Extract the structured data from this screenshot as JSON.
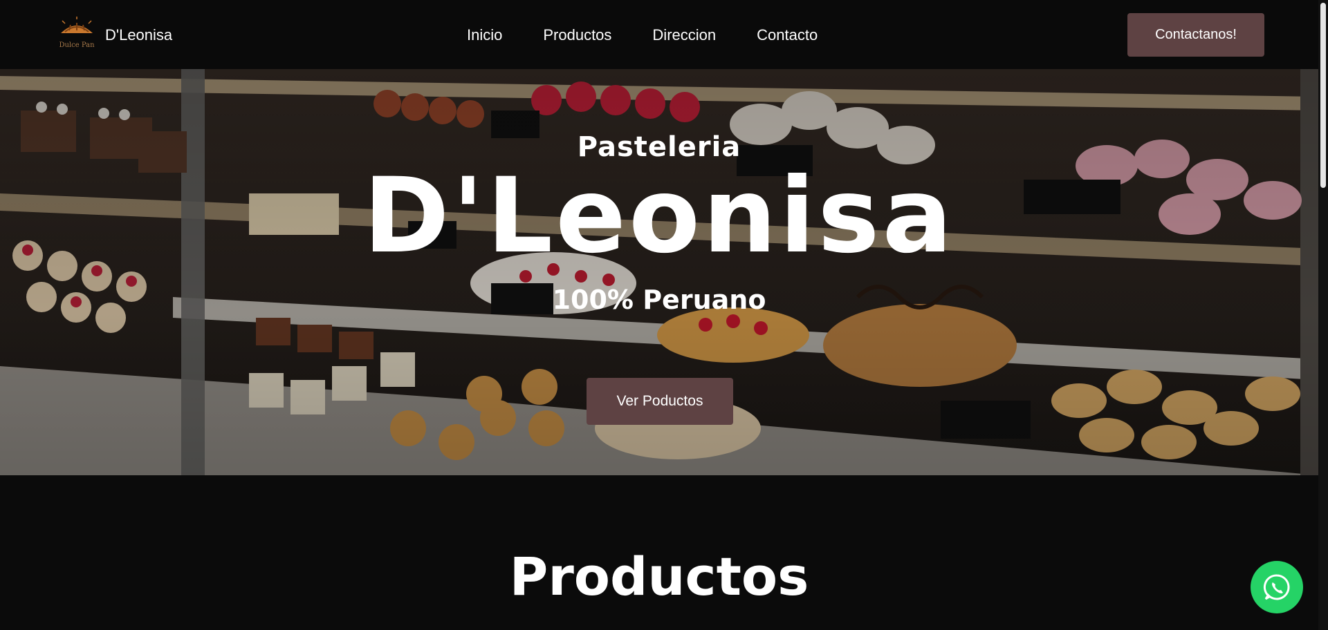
{
  "header": {
    "brand_name": "D'Leonisa",
    "logo_text": "Dulce Pan",
    "logo_icon": "bread-logo-icon",
    "nav": [
      {
        "label": "Inicio"
      },
      {
        "label": "Productos"
      },
      {
        "label": "Direccion"
      },
      {
        "label": "Contacto"
      }
    ],
    "cta_label": "Contactanos!"
  },
  "hero": {
    "subtitle": "Pasteleria",
    "title": "D'Leonisa",
    "tagline": "100% Peruano",
    "button_label": "Ver Poductos",
    "background": "pastry-display-case-photo"
  },
  "products": {
    "heading": "Productos"
  },
  "whatsapp": {
    "icon": "whatsapp-icon"
  },
  "colors": {
    "background": "#0b0b0b",
    "accent": "#5e4243",
    "whatsapp": "#25d366",
    "text": "#ffffff"
  }
}
